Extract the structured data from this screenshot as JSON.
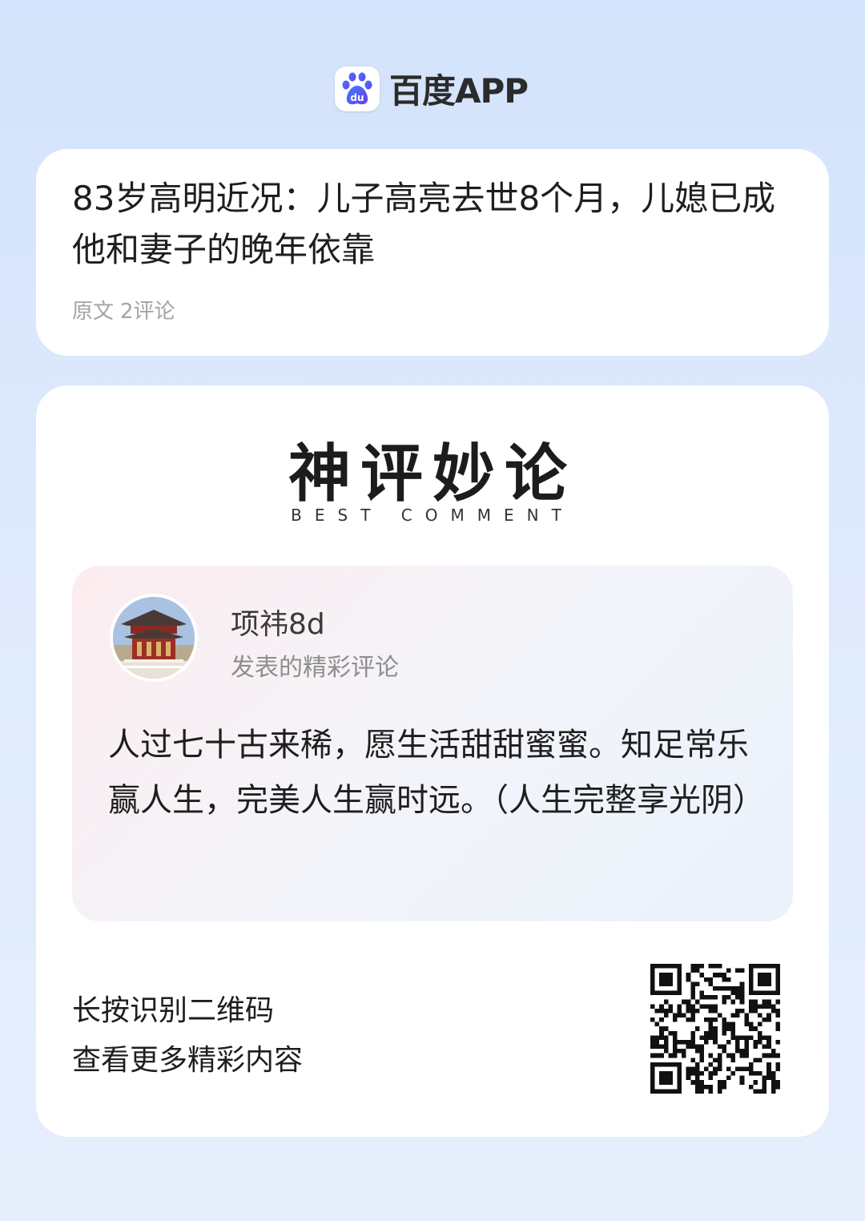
{
  "brand": {
    "name": "百度APP",
    "logo_icon": "baidu-paw-logo-icon",
    "logo_text": "du",
    "color": "#3b6cf6"
  },
  "article": {
    "title": "83岁高明近况：儿子高亮去世8个月，儿媳已成他和妻子的晚年依靠",
    "meta_source": "原文",
    "meta_comments": "2评论"
  },
  "best_comment": {
    "heading": "神评妙论",
    "subheading": "BEST COMMENT",
    "user": {
      "name": "项祎8d",
      "subtitle": "发表的精彩评论",
      "avatar_icon": "pagoda-avatar-icon"
    },
    "text": "人过七十古来稀，愿生活甜甜蜜蜜。知足常乐赢人生，完美人生赢时远。（人生完整享光阴）"
  },
  "cta": {
    "line1": "长按识别二维码",
    "line2": "查看更多精彩内容",
    "qr_icon": "qr-code-icon"
  },
  "colors": {
    "background": "#d9e7fc",
    "card": "#ffffff",
    "text": "#1e1e1e",
    "muted": "#a3a3a3"
  }
}
